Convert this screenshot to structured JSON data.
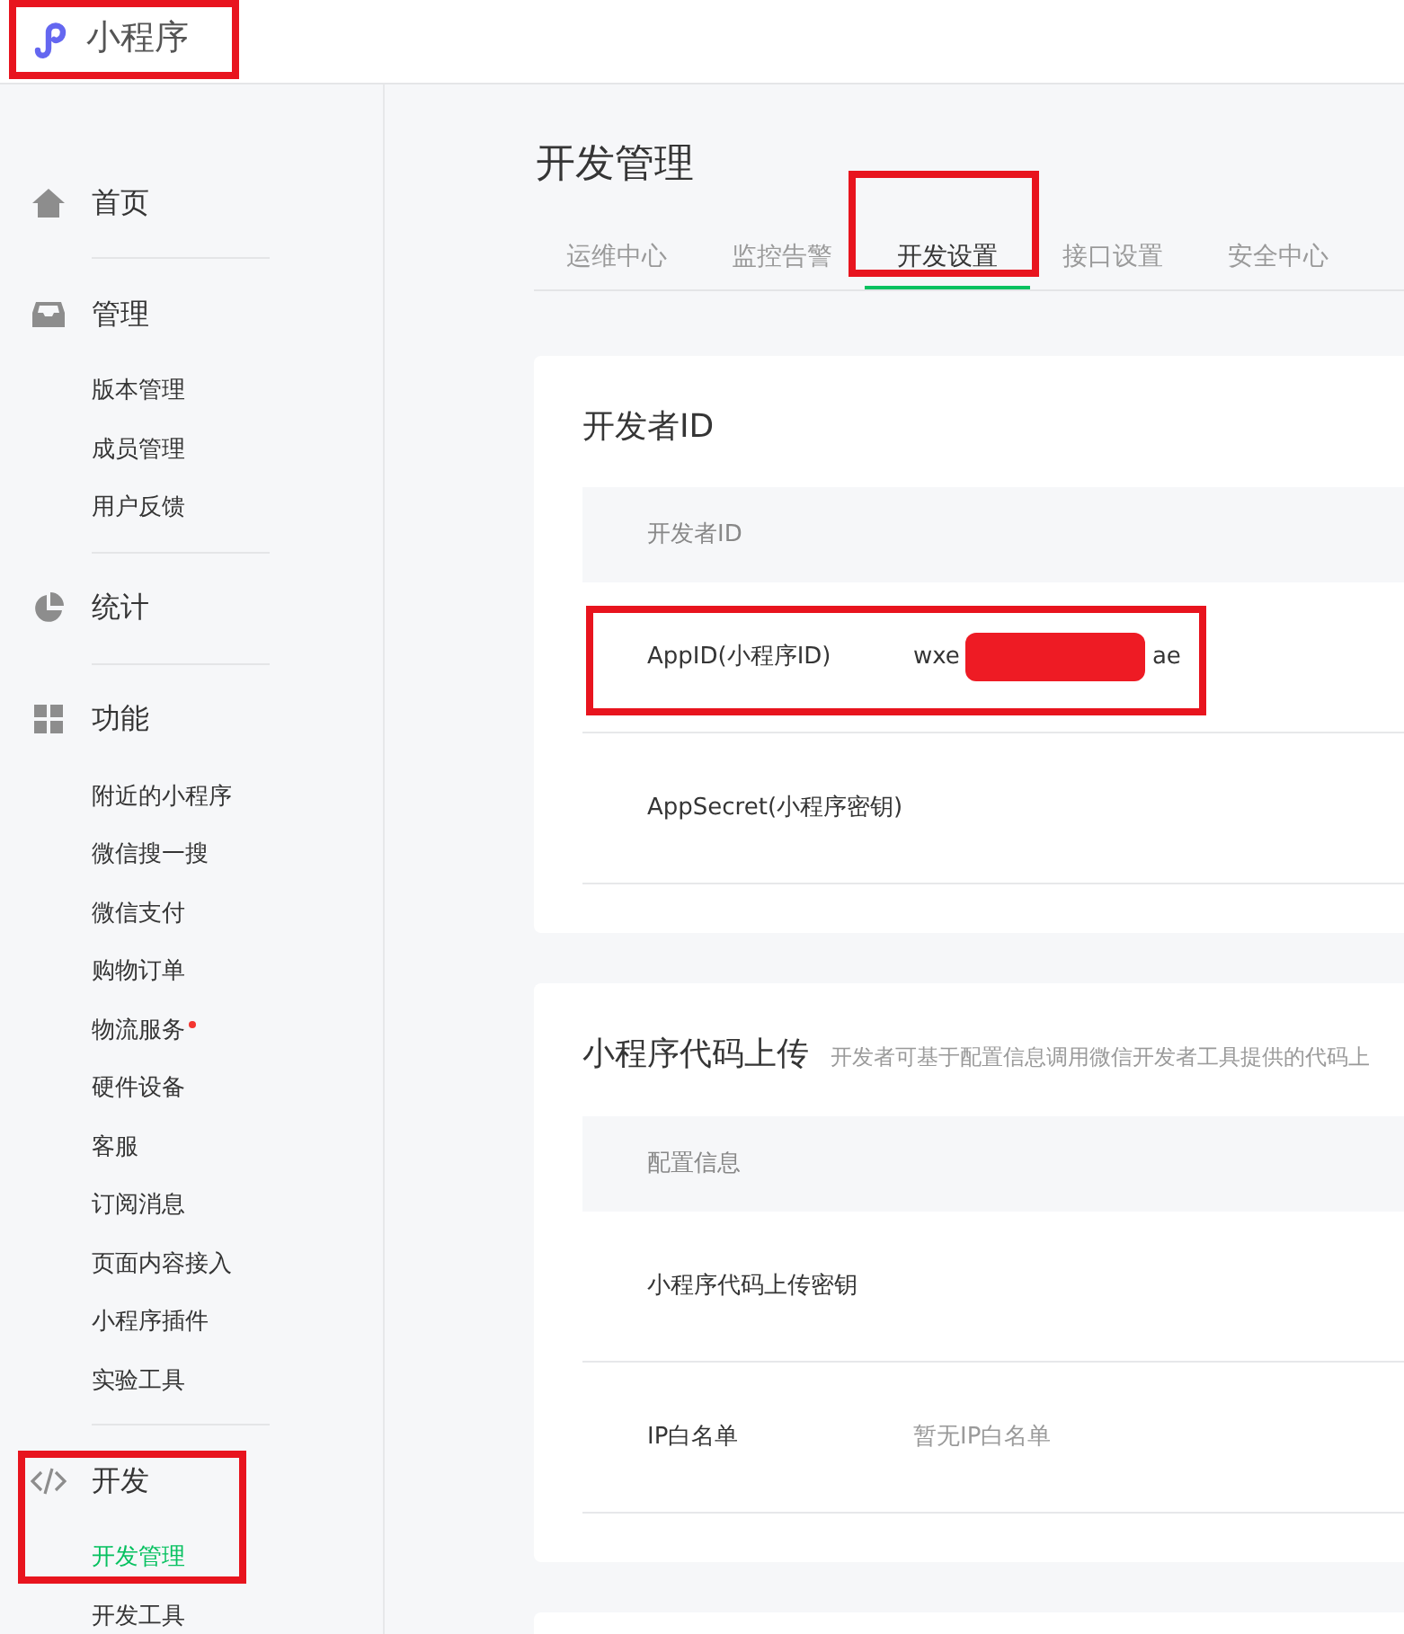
{
  "header": {
    "logo": "小程序",
    "highlighted": true
  },
  "sidebar": {
    "groups": [
      {
        "kind": "home",
        "label": "首页",
        "highlighted": false
      },
      {
        "kind": "inbox",
        "label": "管理",
        "highlighted": false,
        "items": [
          {
            "label": "版本管理",
            "selected": false,
            "dot": false
          },
          {
            "label": "成员管理",
            "selected": false,
            "dot": false
          },
          {
            "label": "用户反馈",
            "selected": false,
            "dot": false
          }
        ]
      },
      {
        "kind": "pie",
        "label": "统计",
        "highlighted": false
      },
      {
        "kind": "grid",
        "label": "功能",
        "highlighted": false,
        "items": [
          {
            "label": "附近的小程序",
            "selected": false,
            "dot": false
          },
          {
            "label": "微信搜一搜",
            "selected": false,
            "dot": false
          },
          {
            "label": "微信支付",
            "selected": false,
            "dot": false
          },
          {
            "label": "购物订单",
            "selected": false,
            "dot": false
          },
          {
            "label": "物流服务",
            "selected": false,
            "dot": true
          },
          {
            "label": "硬件设备",
            "selected": false,
            "dot": false
          },
          {
            "label": "客服",
            "selected": false,
            "dot": false
          },
          {
            "label": "订阅消息",
            "selected": false,
            "dot": false
          },
          {
            "label": "页面内容接入",
            "selected": false,
            "dot": false
          },
          {
            "label": "小程序插件",
            "selected": false,
            "dot": false
          },
          {
            "label": "实验工具",
            "selected": false,
            "dot": false
          }
        ]
      },
      {
        "kind": "code",
        "label": "开发",
        "highlighted": true,
        "items": [
          {
            "label": "开发管理",
            "selected": true,
            "dot": false
          },
          {
            "label": "开发工具",
            "selected": false,
            "dot": false
          }
        ]
      }
    ]
  },
  "main": {
    "title": "开发管理",
    "tabs": [
      {
        "label": "运维中心",
        "selected": false,
        "highlighted": false
      },
      {
        "label": "监控告警",
        "selected": false,
        "highlighted": false
      },
      {
        "label": "开发设置",
        "selected": true,
        "highlighted": true
      },
      {
        "label": "接口设置",
        "selected": false,
        "highlighted": false
      },
      {
        "label": "安全中心",
        "selected": false,
        "highlighted": false
      }
    ],
    "sections": [
      {
        "title": "开发者ID",
        "header": "开发者ID",
        "rows": [
          {
            "kind": "secret",
            "label": "AppID(小程序ID)",
            "value": "wxe",
            "value_end": "ae",
            "highlighted": true
          },
          {
            "kind": "plain",
            "label": "AppSecret(小程序密钥)",
            "highlighted": false
          }
        ]
      },
      {
        "title": "小程序代码上传",
        "description": "开发者可基于配置信息调用微信开发者工具提供的代码上",
        "header": "配置信息",
        "rows": [
          {
            "kind": "plain",
            "label": "小程序代码上传密钥",
            "highlighted": false
          },
          {
            "kind": "note",
            "label": "IP白名单",
            "value": "暂无IP白名单",
            "highlighted": false
          }
        ]
      }
    ]
  }
}
